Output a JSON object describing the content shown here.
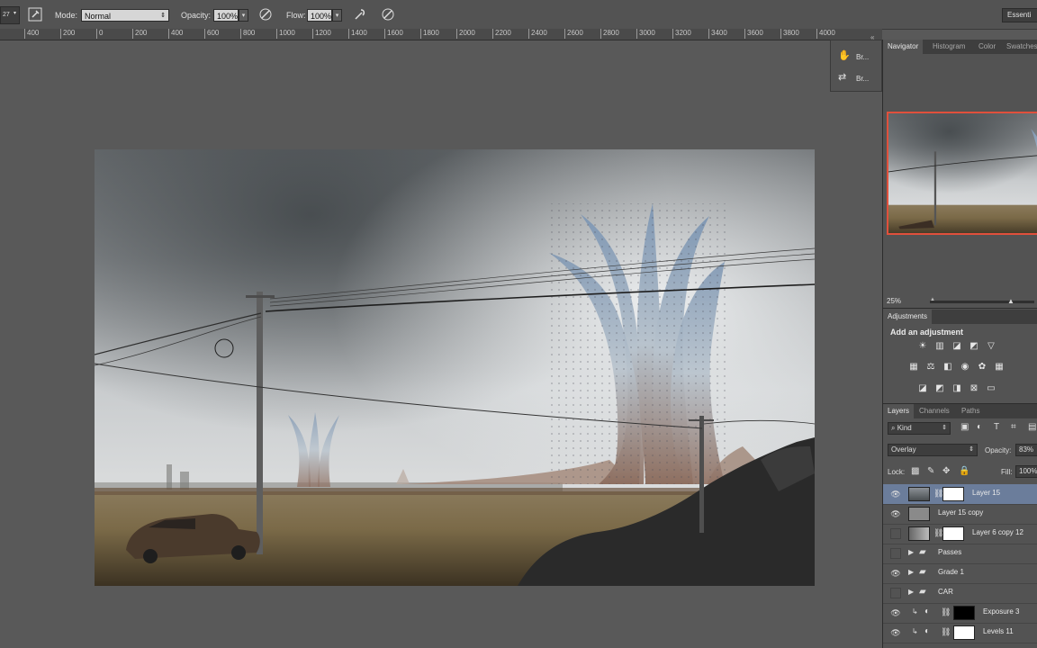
{
  "options_bar": {
    "brush_size": "27",
    "mode_label": "Mode:",
    "mode_value": "Normal",
    "opacity_label": "Opacity:",
    "opacity_value": "100%",
    "flow_label": "Flow:",
    "flow_value": "100%",
    "workspace": "Essenti"
  },
  "ruler": {
    "ticks": [
      "400",
      "200",
      "0",
      "200",
      "400",
      "600",
      "800",
      "1000",
      "1200",
      "1400",
      "1600",
      "1800",
      "2000",
      "2200",
      "2400",
      "2600",
      "2800",
      "3000",
      "3200",
      "3400",
      "3600",
      "3800",
      "4000"
    ]
  },
  "brush_panel": {
    "items": [
      {
        "label": "Br...",
        "icon": "brush-preset-icon"
      },
      {
        "label": "Br...",
        "icon": "clone-source-icon"
      }
    ]
  },
  "navigator": {
    "tabs": [
      "Navigator",
      "Histogram",
      "Color",
      "Swatches"
    ],
    "active_tab": "Navigator",
    "zoom": "25%",
    "zoom_fraction": 0.78
  },
  "adjustments": {
    "tab": "Adjustments",
    "heading": "Add an adjustment",
    "row1": [
      "brightness-contrast-icon",
      "levels-icon",
      "curves-icon",
      "exposure-icon",
      "vibrance-icon"
    ],
    "row2": [
      "hue-saturation-icon",
      "color-balance-icon",
      "black-white-icon",
      "photo-filter-icon",
      "channel-mixer-icon",
      "color-lookup-icon"
    ],
    "row3": [
      "invert-icon",
      "posterize-icon",
      "threshold-icon",
      "selective-color-icon",
      "gradient-map-icon"
    ]
  },
  "layers_panel": {
    "tabs": [
      "Layers",
      "Channels",
      "Paths"
    ],
    "active_tab": "Layers",
    "filter_kind": "Kind",
    "blend_mode": "Overlay",
    "opacity_label": "Opacity:",
    "opacity_value": "83%",
    "lock_label": "Lock:",
    "fill_label": "Fill:",
    "fill_value": "100%",
    "layers": [
      {
        "name": "Layer 15",
        "type": "image-mask",
        "selected": true,
        "visible": true
      },
      {
        "name": "Layer 15 copy",
        "type": "image",
        "selected": false,
        "visible": true
      },
      {
        "name": "Layer 6 copy 12",
        "type": "image-mask",
        "selected": false,
        "visible": false
      },
      {
        "name": "Passes",
        "type": "group",
        "selected": false,
        "visible": false
      },
      {
        "name": "Grade 1",
        "type": "group",
        "selected": false,
        "visible": true
      },
      {
        "name": "CAR",
        "type": "group",
        "selected": false,
        "visible": false
      },
      {
        "name": "Exposure 3",
        "type": "adjustment",
        "selected": false,
        "visible": true
      },
      {
        "name": "Levels 11",
        "type": "adjustment",
        "selected": false,
        "visible": true
      }
    ]
  },
  "colors": {
    "selection": "#6b7d9b",
    "navigator_frame": "#e0503c"
  }
}
